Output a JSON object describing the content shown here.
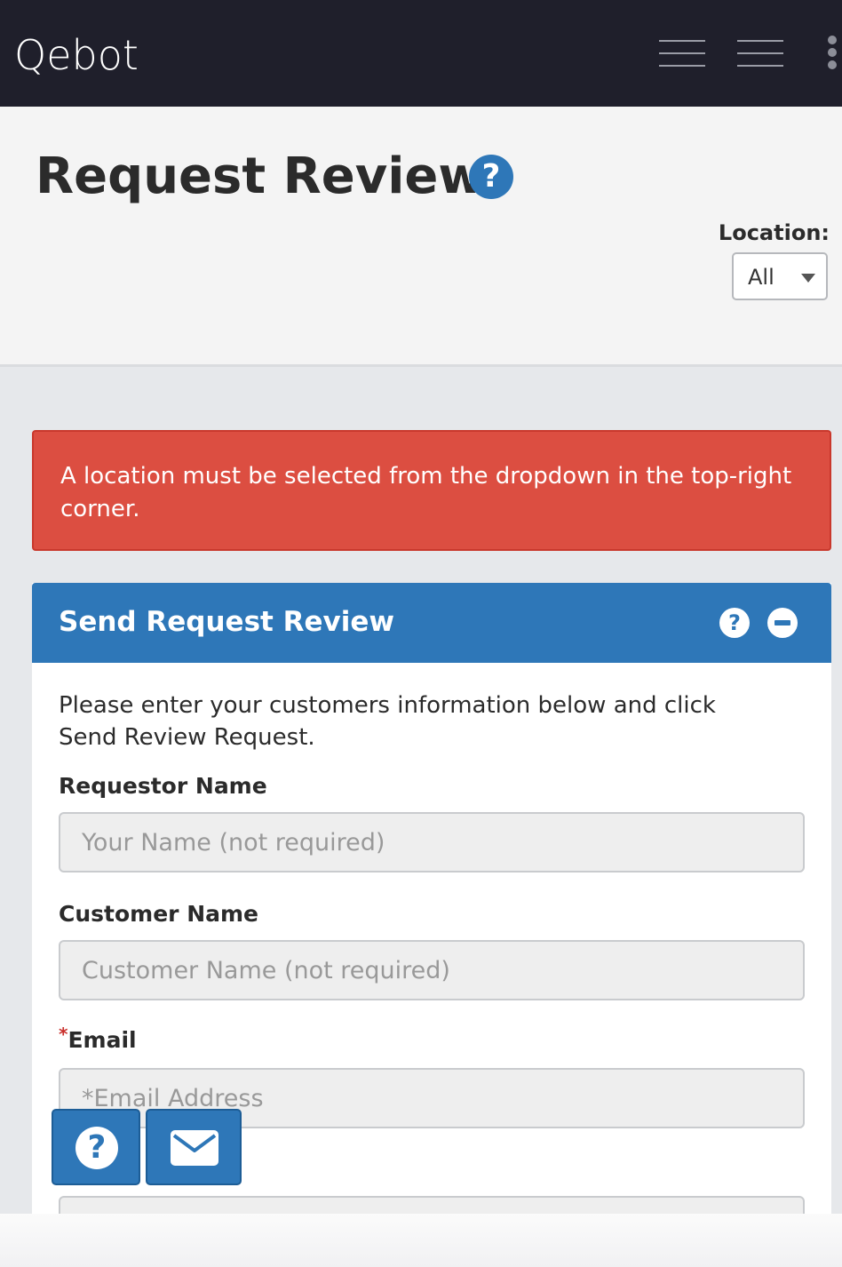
{
  "navbar": {
    "brand": "Qebot",
    "menu_icon_1": "hamburger-menu-icon",
    "menu_icon_2": "hamburger-menu-icon",
    "more_icon": "kebab-menu-icon"
  },
  "header": {
    "title": "Request Review",
    "help_icon": "question-circle-icon",
    "location_label": "Location:",
    "location_value": "All"
  },
  "alert": {
    "message": "A location must be selected from the dropdown in the top-right corner.",
    "color": "#dc4e41"
  },
  "card": {
    "title": "Send Request Review",
    "intro": "Please enter your customers information below and click Send Review Request.",
    "fields": [
      {
        "label": "Requestor Name",
        "placeholder": "Your Name (not required)",
        "required": false
      },
      {
        "label": "Customer Name",
        "placeholder": "Customer Name (not required)",
        "required": false
      },
      {
        "label": "Email",
        "placeholder": "*Email Address",
        "required": true
      }
    ],
    "required_marker": "*",
    "accent": "#2e77b8"
  },
  "fab": {
    "help_icon": "question-circle-icon",
    "mail_icon": "envelope-icon"
  }
}
